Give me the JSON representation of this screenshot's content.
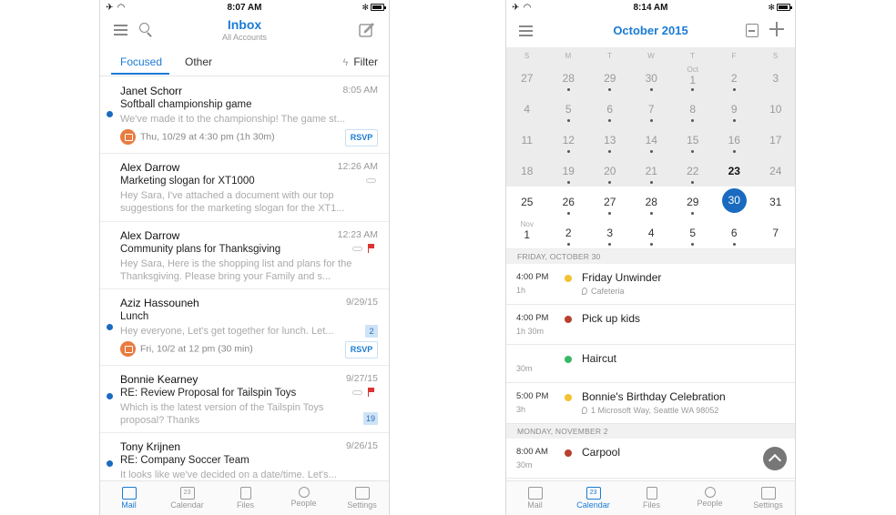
{
  "mail": {
    "status": {
      "time": "8:07 AM"
    },
    "header": {
      "title": "Inbox",
      "subtitle": "All Accounts"
    },
    "tabs": {
      "focused": "Focused",
      "other": "Other",
      "filter": "Filter"
    },
    "messages": [
      {
        "sender": "Janet Schorr",
        "time": "8:05 AM",
        "subject": "Softball championship game",
        "preview": "We've made it to the championship! The game st...",
        "event": "Thu, 10/29 at 4:30 pm (1h 30m)",
        "rsvp": "RSVP"
      },
      {
        "sender": "Alex Darrow",
        "time": "12:26 AM",
        "subject": "Marketing slogan for XT1000",
        "preview": "Hey Sara, I've attached a document with our top suggestions for the marketing slogan for the XT1..."
      },
      {
        "sender": "Alex Darrow",
        "time": "12:23 AM",
        "subject": "Community plans for Thanksgiving",
        "preview": "Hey Sara, Here is the shopping list and plans for the Thanksgiving. Please bring your Family and s..."
      },
      {
        "sender": "Aziz Hassouneh",
        "time": "9/29/15",
        "subject": "Lunch",
        "preview": "Hey everyone, Let's get together for lunch. Let...",
        "count": "2",
        "event": "Fri, 10/2 at 12 pm (30 min)",
        "rsvp": "RSVP"
      },
      {
        "sender": "Bonnie Kearney",
        "time": "9/27/15",
        "subject": "RE: Review Proposal for Tailspin Toys",
        "preview": "Which is the latest version of the Tailspin Toys proposal? Thanks",
        "count": "19"
      },
      {
        "sender": "Tony Krijnen",
        "time": "9/26/15",
        "subject": "RE: Company Soccer Team",
        "preview": "It looks like we've decided on a date/time. Let's..."
      }
    ],
    "tabbar": [
      "Mail",
      "Calendar",
      "Files",
      "People",
      "Settings"
    ],
    "tabbar_glyphs": {
      "calendar": "23"
    }
  },
  "calendar": {
    "status": {
      "time": "8:14 AM"
    },
    "header": {
      "title": "October 2015"
    },
    "weekdays": [
      "S",
      "M",
      "T",
      "W",
      "T",
      "F",
      "S"
    ],
    "weeks": [
      [
        {
          "d": "27"
        },
        {
          "d": "28",
          "dot": true
        },
        {
          "d": "29",
          "dot": true
        },
        {
          "d": "30",
          "dot": true
        },
        {
          "d": "1",
          "m": "Oct",
          "dot": true
        },
        {
          "d": "2",
          "dot": true
        },
        {
          "d": "3"
        }
      ],
      [
        {
          "d": "4"
        },
        {
          "d": "5",
          "dot": true
        },
        {
          "d": "6",
          "dot": true
        },
        {
          "d": "7",
          "dot": true
        },
        {
          "d": "8",
          "dot": true
        },
        {
          "d": "9",
          "dot": true
        },
        {
          "d": "10"
        }
      ],
      [
        {
          "d": "11"
        },
        {
          "d": "12",
          "dot": true
        },
        {
          "d": "13",
          "dot": true
        },
        {
          "d": "14",
          "dot": true
        },
        {
          "d": "15",
          "dot": true
        },
        {
          "d": "16",
          "dot": true
        },
        {
          "d": "17"
        }
      ],
      [
        {
          "d": "18"
        },
        {
          "d": "19",
          "dot": true
        },
        {
          "d": "20",
          "dot": true
        },
        {
          "d": "21",
          "dot": true
        },
        {
          "d": "22",
          "dot": true
        },
        {
          "d": "23",
          "today": true
        },
        {
          "d": "24"
        }
      ],
      [
        {
          "d": "25",
          "light": true
        },
        {
          "d": "26",
          "light": true,
          "dot": true
        },
        {
          "d": "27",
          "light": true,
          "dot": true
        },
        {
          "d": "28",
          "light": true,
          "dot": true
        },
        {
          "d": "29",
          "light": true,
          "dot": true
        },
        {
          "d": "30",
          "light": true,
          "selected": true
        },
        {
          "d": "31",
          "light": true
        }
      ],
      [
        {
          "d": "1",
          "m": "Nov",
          "light": true
        },
        {
          "d": "2",
          "light": true,
          "dot": true
        },
        {
          "d": "3",
          "light": true,
          "dot": true
        },
        {
          "d": "4",
          "light": true,
          "dot": true
        },
        {
          "d": "5",
          "light": true,
          "dot": true
        },
        {
          "d": "6",
          "light": true,
          "dot": true
        },
        {
          "d": "7",
          "light": true
        }
      ]
    ],
    "sections": [
      {
        "label": "FRIDAY, OCTOBER 30",
        "events": [
          {
            "time": "4:00 PM",
            "duration": "1h",
            "title": "Friday Unwinder",
            "location": "Cafeteria",
            "color": "#f2c230"
          },
          {
            "time": "4:00 PM",
            "duration": "1h 30m",
            "title": "Pick up kids",
            "color": "#b8402e"
          },
          {
            "time": "",
            "duration": "30m",
            "title": "Haircut",
            "color": "#38b866"
          },
          {
            "time": "5:00 PM",
            "duration": "3h",
            "title": "Bonnie's Birthday Celebration",
            "location": "1 Microsoft Way, Seattle WA 98052",
            "color": "#f2c230"
          }
        ]
      },
      {
        "label": "MONDAY, NOVEMBER 2",
        "events": [
          {
            "time": "8:00 AM",
            "duration": "30m",
            "title": "Carpool",
            "color": "#b8402e"
          }
        ]
      }
    ],
    "tabbar": [
      "Mail",
      "Calendar",
      "Files",
      "People",
      "Settings"
    ],
    "tabbar_glyphs": {
      "calendar": "23"
    }
  },
  "colors": {
    "accent": "#1a7bd5",
    "unread": "#1a6bbf",
    "selected_day": "#1a6bbf"
  }
}
